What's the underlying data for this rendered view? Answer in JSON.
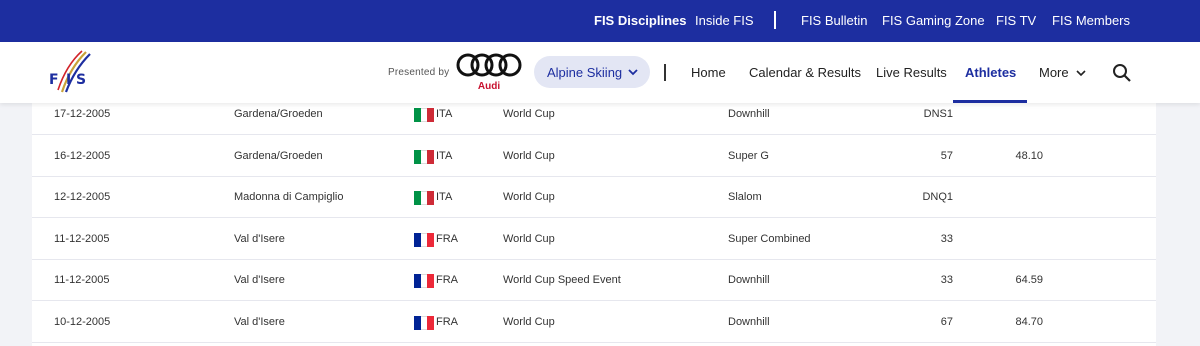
{
  "topbar": {
    "links": [
      "FIS Disciplines",
      "Inside FIS",
      "FIS Bulletin",
      "FIS Gaming Zone",
      "FIS TV",
      "FIS Members"
    ]
  },
  "navbar": {
    "presented_by": "Presented by",
    "sponsor": "Audi",
    "discipline": "Alpine Skiing",
    "items": [
      "Home",
      "Calendar & Results",
      "Live Results",
      "Athletes",
      "More"
    ],
    "active_item": "Athletes"
  },
  "colors": {
    "brand": "#1d2ea0",
    "audi_red": "#c8102e",
    "flag_ita": [
      "#009246",
      "#ffffff",
      "#ce2b37"
    ],
    "flag_fra": [
      "#002395",
      "#ffffff",
      "#ed2939"
    ]
  },
  "results": [
    {
      "date": "17-12-2005",
      "place": "Gardena/Groeden",
      "nation": "ITA",
      "category": "World Cup",
      "discipline": "Downhill",
      "rank": "DNS1",
      "points": ""
    },
    {
      "date": "16-12-2005",
      "place": "Gardena/Groeden",
      "nation": "ITA",
      "category": "World Cup",
      "discipline": "Super G",
      "rank": "57",
      "points": "48.10"
    },
    {
      "date": "12-12-2005",
      "place": "Madonna di Campiglio",
      "nation": "ITA",
      "category": "World Cup",
      "discipline": "Slalom",
      "rank": "DNQ1",
      "points": ""
    },
    {
      "date": "11-12-2005",
      "place": "Val d'Isere",
      "nation": "FRA",
      "category": "World Cup",
      "discipline": "Super Combined",
      "rank": "33",
      "points": ""
    },
    {
      "date": "11-12-2005",
      "place": "Val d'Isere",
      "nation": "FRA",
      "category": "World Cup Speed Event",
      "discipline": "Downhill",
      "rank": "33",
      "points": "64.59"
    },
    {
      "date": "10-12-2005",
      "place": "Val d'Isere",
      "nation": "FRA",
      "category": "World Cup",
      "discipline": "Downhill",
      "rank": "67",
      "points": "84.70"
    }
  ]
}
